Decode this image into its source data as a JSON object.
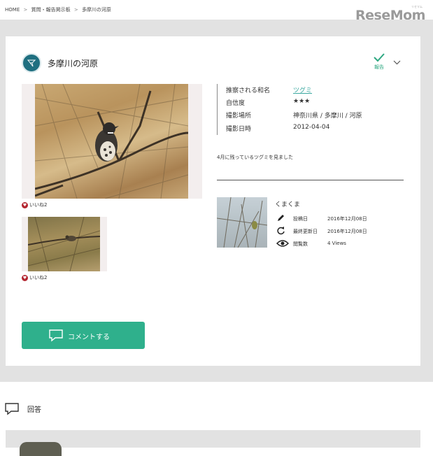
{
  "breadcrumb": [
    "HOME",
    "質問・報告掲示板",
    "多摩川の河原"
  ],
  "breadcrumb_sep": ">",
  "logo": {
    "text": "ReseMom",
    "sub": "リセマム"
  },
  "post": {
    "title": "多摩川の河原",
    "report_label": "報告",
    "main_photo_likes": "いいね2",
    "thumb_photo_likes": "いいね2",
    "info": [
      {
        "label": "推察される和名",
        "value": "ツグミ",
        "link": true
      },
      {
        "label": "自信度",
        "value": "★★★"
      },
      {
        "label": "撮影場所",
        "value": "神奈川県 / 多摩川 / 河原"
      },
      {
        "label": "撮影日時",
        "value": "2012-04-04"
      }
    ],
    "comment": "4月に残っているツグミを見ました",
    "user": {
      "name": "くまくま",
      "meta": [
        {
          "icon": "pencil-icon",
          "label": "投稿日",
          "value": "2016年12月08日"
        },
        {
          "icon": "refresh-icon",
          "label": "最終更新日",
          "value": "2016年12月08日"
        },
        {
          "icon": "eye-icon",
          "label": "閲覧数",
          "value": "4 Views"
        }
      ]
    },
    "comment_button": "コメントする"
  },
  "answers": {
    "label": "回答"
  },
  "colors": {
    "accent": "#2fb08c",
    "link": "#3aa8a0",
    "heart": "#b32630",
    "avatar": "#1f6f80",
    "bg": "#e2e2e2"
  }
}
